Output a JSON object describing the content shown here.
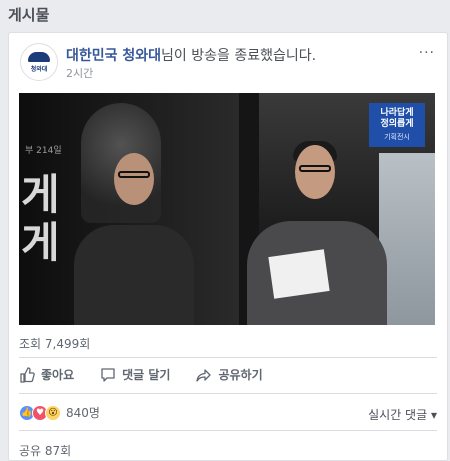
{
  "section_title": "게시물",
  "post": {
    "page_name": "대한민국 청와대",
    "action_text": "님이 방송을 종료했습니다.",
    "timestamp": "2시간",
    "more_label": "···",
    "avatar_text": "청와대",
    "video": {
      "poster_left_small": "부 214일",
      "poster_char_1": "게",
      "poster_char_2": "게",
      "logo_line_1": "나라답게",
      "logo_line_2": "정의롭게",
      "logo_sub": "기획전시"
    },
    "views": "조회 7,499회",
    "actions": {
      "like": "좋아요",
      "comment": "댓글 달기",
      "share": "공유하기"
    },
    "reaction_count": "840명",
    "comment_sort": "실시간 댓글",
    "shares": "공유 87회"
  }
}
